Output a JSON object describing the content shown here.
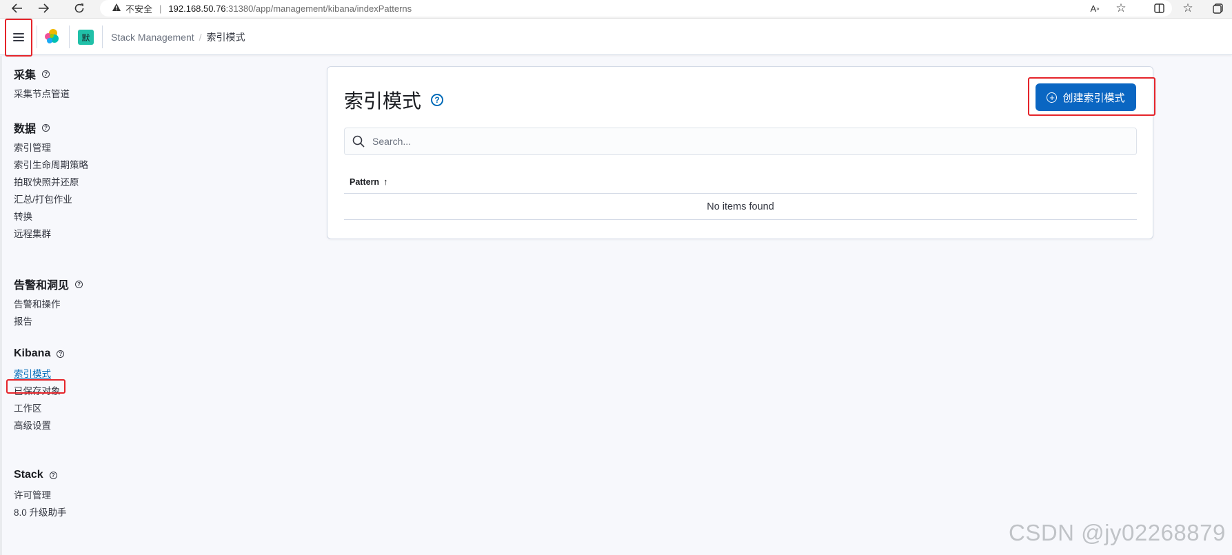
{
  "browser": {
    "warning_icon": "warning-triangle-icon",
    "insecure_label": "不安全",
    "url_host": "192.168.50.76",
    "url_rest": ":31380/app/management/kibana/indexPatterns"
  },
  "header": {
    "space_initial": "默",
    "breadcrumb": {
      "parent": "Stack Management",
      "current": "索引模式"
    }
  },
  "sidebar": {
    "groups": [
      {
        "title": "采集",
        "items": [
          "采集节点管道"
        ]
      },
      {
        "title": "数据",
        "items": [
          "索引管理",
          "索引生命周期策略",
          "拍取快照并还原",
          "汇总/打包作业",
          "转换",
          "远程集群"
        ]
      },
      {
        "title": "告警和洞见",
        "items": [
          "告警和操作",
          "报告"
        ]
      },
      {
        "title": "Kibana",
        "items": [
          "索引模式",
          "已保存对象",
          "工作区",
          "高级设置"
        ]
      },
      {
        "title": "Stack",
        "items": [
          "许可管理",
          "8.0 升级助手"
        ]
      }
    ],
    "active_item": "索引模式"
  },
  "main": {
    "title": "索引模式",
    "create_button_label": "创建索引模式",
    "search_placeholder": "Search...",
    "table": {
      "columns": [
        "Pattern"
      ],
      "sort": "ascending",
      "empty_message": "No items found"
    }
  },
  "watermark": "CSDN @jy02268879",
  "colors": {
    "primary": "#0a66c2",
    "highlight": "#e5242a",
    "space_avatar": "#20c0a8"
  }
}
